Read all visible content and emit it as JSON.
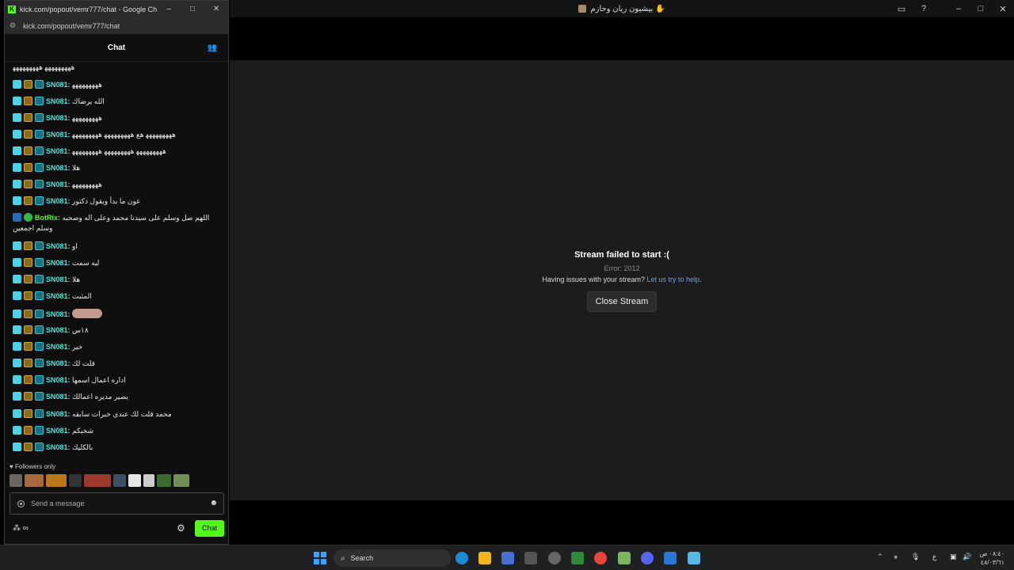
{
  "main_window": {
    "title": "بيشيون ريان وحازم ✋",
    "error_title": "Stream failed to start :(",
    "error_code": "Error: 2012",
    "help_text": "Having issues with your stream?",
    "help_link": "Let us try to help",
    "help_end": ".",
    "close_button": "Close Stream"
  },
  "popup": {
    "title": "kick.com/popout/vemr777/chat - Google Chro...",
    "url": "kick.com/popout/vemr777/chat",
    "chat_title": "Chat",
    "first_line": "ﻫﻬﻬﻬﻬﻬﻬﻬﻬ ﻫﻬﻬﻬﻬﻬﻬﻬﻬ",
    "messages": [
      {
        "user": "SN081:",
        "text": "ﻫﻬﻬﻬﻬﻬﻬﻬﻬ"
      },
      {
        "user": "SN081:",
        "text": "الله يرضاك"
      },
      {
        "user": "SN081:",
        "text": "ﻫﻬﻬﻬﻬﻬﻬﻬﻬ"
      },
      {
        "user": "SN081:",
        "text": "ﻫﻬﻬﻬﻬﻬﻬﻬﻬ هع ﻫﻬﻬﻬﻬﻬﻬﻬﻬ ﻫﻬﻬﻬﻬﻬﻬﻬﻬ"
      },
      {
        "user": "SN081:",
        "text": "ﻫﻬﻬﻬﻬﻬﻬﻬﻬ ﻫﻬﻬﻬﻬﻬﻬﻬﻬ ﻫﻬﻬﻬﻬﻬﻬﻬﻬ"
      },
      {
        "user": "SN081:",
        "text": "هلا"
      },
      {
        "user": "SN081:",
        "text": "ﻫﻬﻬﻬﻬﻬﻬﻬﻬ"
      },
      {
        "user": "SN081:",
        "text": "عون ما بدأ ويقول دكتور"
      },
      {
        "user": "BotRix:",
        "text": "اللهم صل وسلم على سيدنا محمد وعلى اله وصحبه وسلم اجمعين",
        "bot": true
      },
      {
        "user": "SN081:",
        "text": "او"
      },
      {
        "user": "SN081:",
        "text": "ليه سمت"
      },
      {
        "user": "SN081:",
        "text": "هلا"
      },
      {
        "user": "SN081:",
        "text": "المثبت"
      },
      {
        "user": "SN081:",
        "text": "",
        "emote": true
      },
      {
        "user": "SN081:",
        "text": "١٨س"
      },
      {
        "user": "SN081:",
        "text": "خير"
      },
      {
        "user": "SN081:",
        "text": "قلت لك"
      },
      {
        "user": "SN081:",
        "text": "اداره اعمال اسمها"
      },
      {
        "user": "SN081:",
        "text": "يصير مديره اعمالك"
      },
      {
        "user": "SN081:",
        "text": "محمد قلت لك عندي خبرات سابقه"
      },
      {
        "user": "SN081:",
        "text": "شخبكم"
      },
      {
        "user": "SN081:",
        "text": "بالكليك"
      }
    ],
    "followers_only": "Followers only",
    "input_placeholder": "Send a message",
    "points": "∞",
    "chat_button": "Chat"
  },
  "taskbar": {
    "search": "Search",
    "clock_time": "٠٨:٤٠ ص",
    "clock_date": "٤٨/٠٣/٦١",
    "lang": "ع"
  },
  "colors": {
    "kick_green": "#53fc18",
    "username": "#4ee6d8",
    "link": "#6f9eea"
  }
}
